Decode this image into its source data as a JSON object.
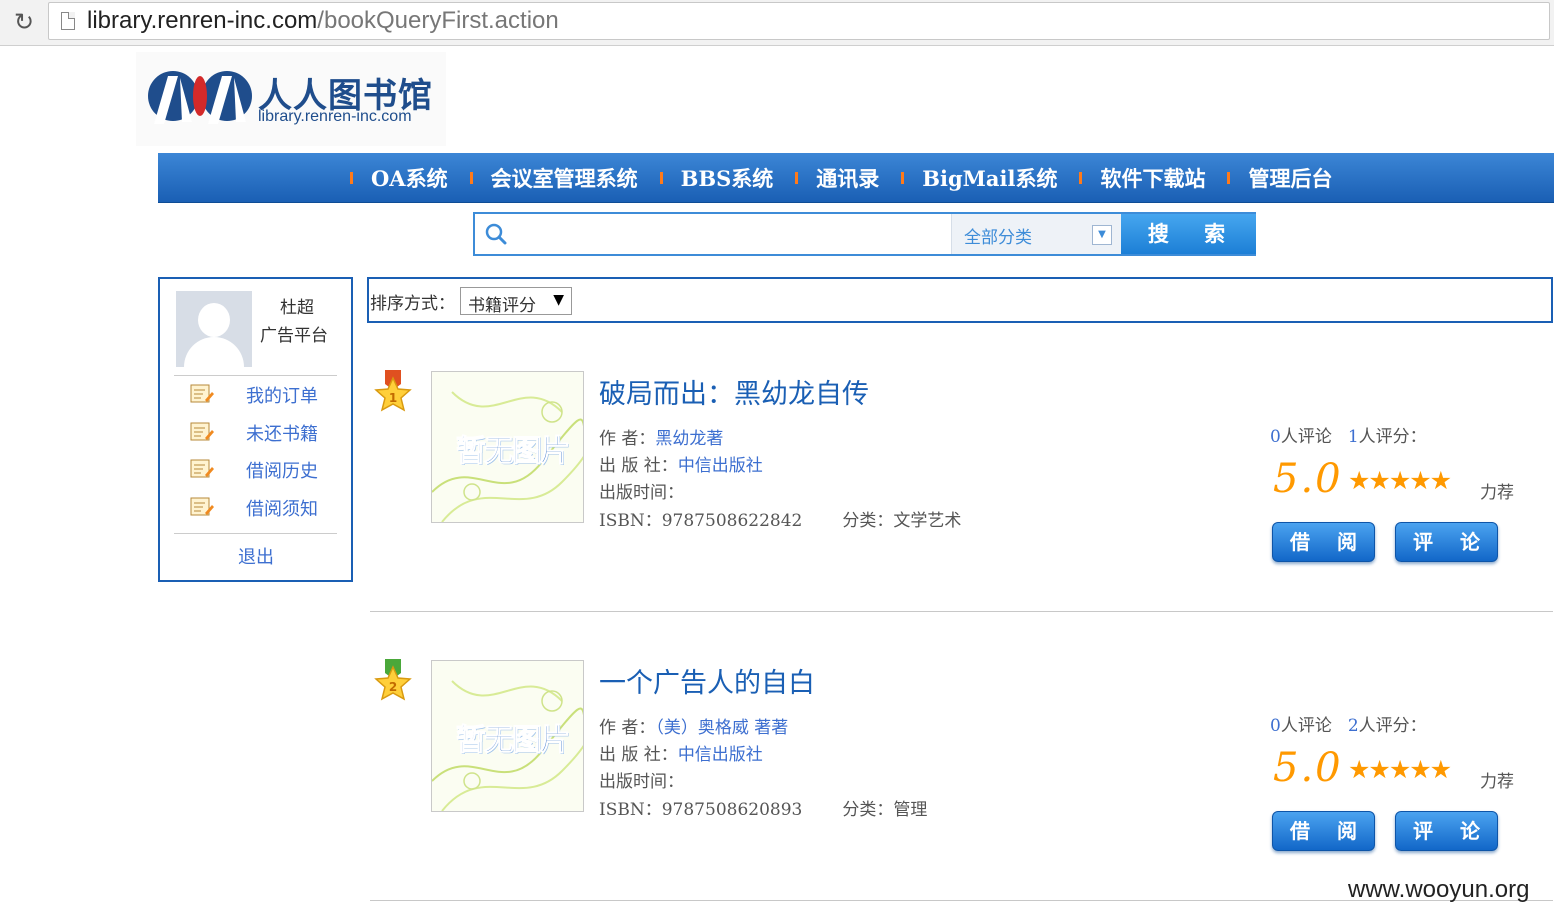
{
  "browser": {
    "url_host": "library.renren-inc.com",
    "url_path": "/bookQueryFirst.action"
  },
  "logo": {
    "title": "人人图书馆",
    "subtitle": "library.renren-inc.com"
  },
  "nav": {
    "items": [
      "OA系统",
      "会议室管理系统",
      "BBS系统",
      "通讯录",
      "BigMail系统",
      "软件下载站",
      "管理后台"
    ]
  },
  "search": {
    "placeholder": "",
    "category": "全部分类",
    "button_label": "搜 索"
  },
  "user": {
    "name": "杜超",
    "department": "广告平台",
    "menu": [
      {
        "label": "我的订单",
        "icon": "note-edit-icon"
      },
      {
        "label": "未还书籍",
        "icon": "note-edit-icon"
      },
      {
        "label": "借阅历史",
        "icon": "note-edit-icon"
      },
      {
        "label": "借阅须知",
        "icon": "note-edit-icon"
      }
    ],
    "logout": "退出"
  },
  "sort": {
    "label": "排序方式：",
    "selected": "书籍评分"
  },
  "books": [
    {
      "rank": "1",
      "badge_color": "#e05020",
      "cover_text": "暂无图片",
      "title": "破局而出：黑幼龙自传",
      "author_label": "作 者：",
      "author": "黑幼龙著",
      "publisher_label": "出 版 社：",
      "publisher": "中信出版社",
      "date_label": "出版时间：",
      "date": "",
      "isbn_label": "ISBN：",
      "isbn": "9787508622842",
      "category_label": "分类：",
      "category": "文学艺术",
      "comments_count": "0",
      "comments_label": "人评论",
      "ratings_count": "1",
      "ratings_label": "人评分：",
      "score": "5.0",
      "stars": "★★★★★",
      "stars_value": 5,
      "recommend": "力荐",
      "borrow_label": "借 阅",
      "comment_label": "评 论"
    },
    {
      "rank": "2",
      "badge_color": "#4aa83a",
      "cover_text": "暂无图片",
      "title": "一个广告人的自白",
      "author_label": "作 者：",
      "author": "（美）奥格威 著著",
      "publisher_label": "出 版 社：",
      "publisher": "中信出版社",
      "date_label": "出版时间：",
      "date": "",
      "isbn_label": "ISBN：",
      "isbn": "9787508620893",
      "category_label": "分类：",
      "category": "管理",
      "comments_count": "0",
      "comments_label": "人评论",
      "ratings_count": "2",
      "ratings_label": "人评分：",
      "score": "5.0",
      "stars": "★★★★★",
      "stars_value": 5,
      "recommend": "力荐",
      "borrow_label": "借 阅",
      "comment_label": "评 论"
    }
  ],
  "watermark": "www.wooyun.org",
  "colors": {
    "nav_blue": "#1a5fb4",
    "accent_orange": "#ff9900",
    "link_blue": "#3d6fd0"
  }
}
